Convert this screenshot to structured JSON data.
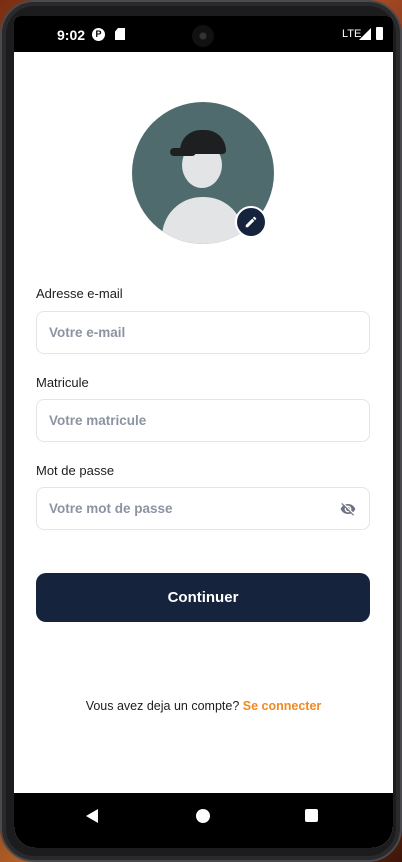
{
  "status_bar": {
    "time": "9:02",
    "network": "LTE",
    "icons": [
      "p-notification-icon",
      "sd-card-icon",
      "signal-icon",
      "battery-icon"
    ]
  },
  "profile": {
    "avatar_icon": "user-avatar",
    "edit_icon": "pencil-icon"
  },
  "form": {
    "email": {
      "label": "Adresse e-mail",
      "placeholder": "Votre e-mail",
      "value": ""
    },
    "matricule": {
      "label": "Matricule",
      "placeholder": "Votre matricule",
      "value": ""
    },
    "password": {
      "label": "Mot de passe",
      "placeholder": "Votre mot de passe",
      "value": "",
      "toggle_icon": "eye-off-icon"
    }
  },
  "continue_label": "Continuer",
  "footer": {
    "prompt": "Vous avez deja un compte?",
    "link": "Se connecter"
  },
  "colors": {
    "primary": "#16233d",
    "accent": "#f08a22",
    "border": "#e3e5ea"
  },
  "nav_bar": {
    "icons": [
      "back-icon",
      "home-icon",
      "recents-icon"
    ]
  }
}
